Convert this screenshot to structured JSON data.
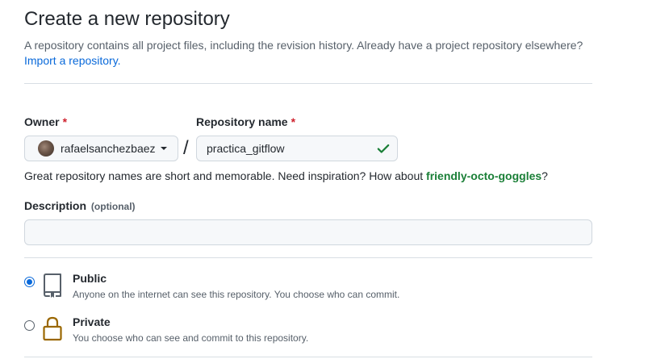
{
  "header": {
    "title": "Create a new repository",
    "subtitle": "A repository contains all project files, including the revision history. Already have a project repository elsewhere?",
    "import_link": "Import a repository."
  },
  "owner": {
    "label": "Owner",
    "required_mark": "*",
    "value": "rafaelsanchezbaez"
  },
  "separator": "/",
  "repo_name": {
    "label": "Repository name",
    "required_mark": "*",
    "value": "practica_gitflow"
  },
  "hint": {
    "text": "Great repository names are short and memorable. Need inspiration? How about",
    "suggestion": "friendly-octo-goggles",
    "end": "?"
  },
  "description": {
    "label": "Description",
    "optional": "(optional)",
    "value": ""
  },
  "visibility": {
    "public": {
      "title": "Public",
      "description": "Anyone on the internet can see this repository. You choose who can commit.",
      "selected": true
    },
    "private": {
      "title": "Private",
      "description": "You choose who can see and commit to this repository.",
      "selected": false
    }
  },
  "colors": {
    "link": "#0969da",
    "required": "#cf222e",
    "success": "#1a7f37",
    "lock": "#9a6700"
  },
  "icons": {
    "public": "repo-icon",
    "private": "lock-icon",
    "valid": "check-icon",
    "dropdown": "caret-down-icon"
  }
}
